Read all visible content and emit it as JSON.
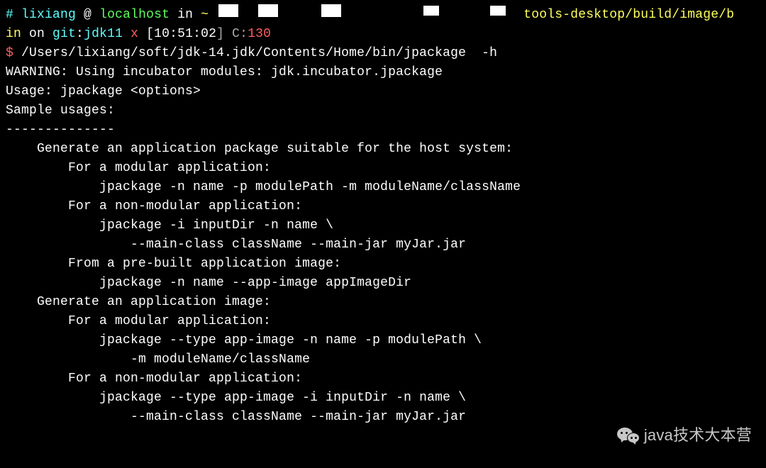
{
  "prompt1": {
    "hash": "#",
    "user": "lixiang",
    "at": " @ ",
    "host": "localhost",
    "in": " in ",
    "path_start": "~",
    "path_end": "tools-desktop/build/image/b"
  },
  "prompt2": {
    "in": "in",
    "on": " on ",
    "git": "git",
    "colon": ":",
    "branch": "jdk11",
    "x": " x ",
    "time_open": "[",
    "time": "10:51:02",
    "time_close": "]",
    "c_label": " C:",
    "c_val": "130"
  },
  "command": {
    "prompt": "$",
    "cmd": " /Users/lixiang/soft/jdk-14.jdk/Contents/Home/bin/jpackage  -h"
  },
  "output": {
    "warning": "WARNING: Using incubator modules: jdk.incubator.jpackage",
    "usage": "Usage: jpackage <options>",
    "blank1": "",
    "sample_hdr": "Sample usages:",
    "dashes": "--------------",
    "l1": "    Generate an application package suitable for the host system:",
    "l2": "        For a modular application:",
    "l3": "            jpackage -n name -p modulePath -m moduleName/className",
    "l4": "        For a non-modular application:",
    "l5": "            jpackage -i inputDir -n name \\",
    "l6": "                --main-class className --main-jar myJar.jar",
    "l7": "        From a pre-built application image:",
    "l8": "            jpackage -n name --app-image appImageDir",
    "l9": "    Generate an application image:",
    "l10": "        For a modular application:",
    "l11": "            jpackage --type app-image -n name -p modulePath \\",
    "l12": "                -m moduleName/className",
    "l13": "        For a non-modular application:",
    "l14": "            jpackage --type app-image -i inputDir -n name \\",
    "l15": "                --main-class className --main-jar myJar.jar"
  },
  "watermark": "java技术大本营"
}
